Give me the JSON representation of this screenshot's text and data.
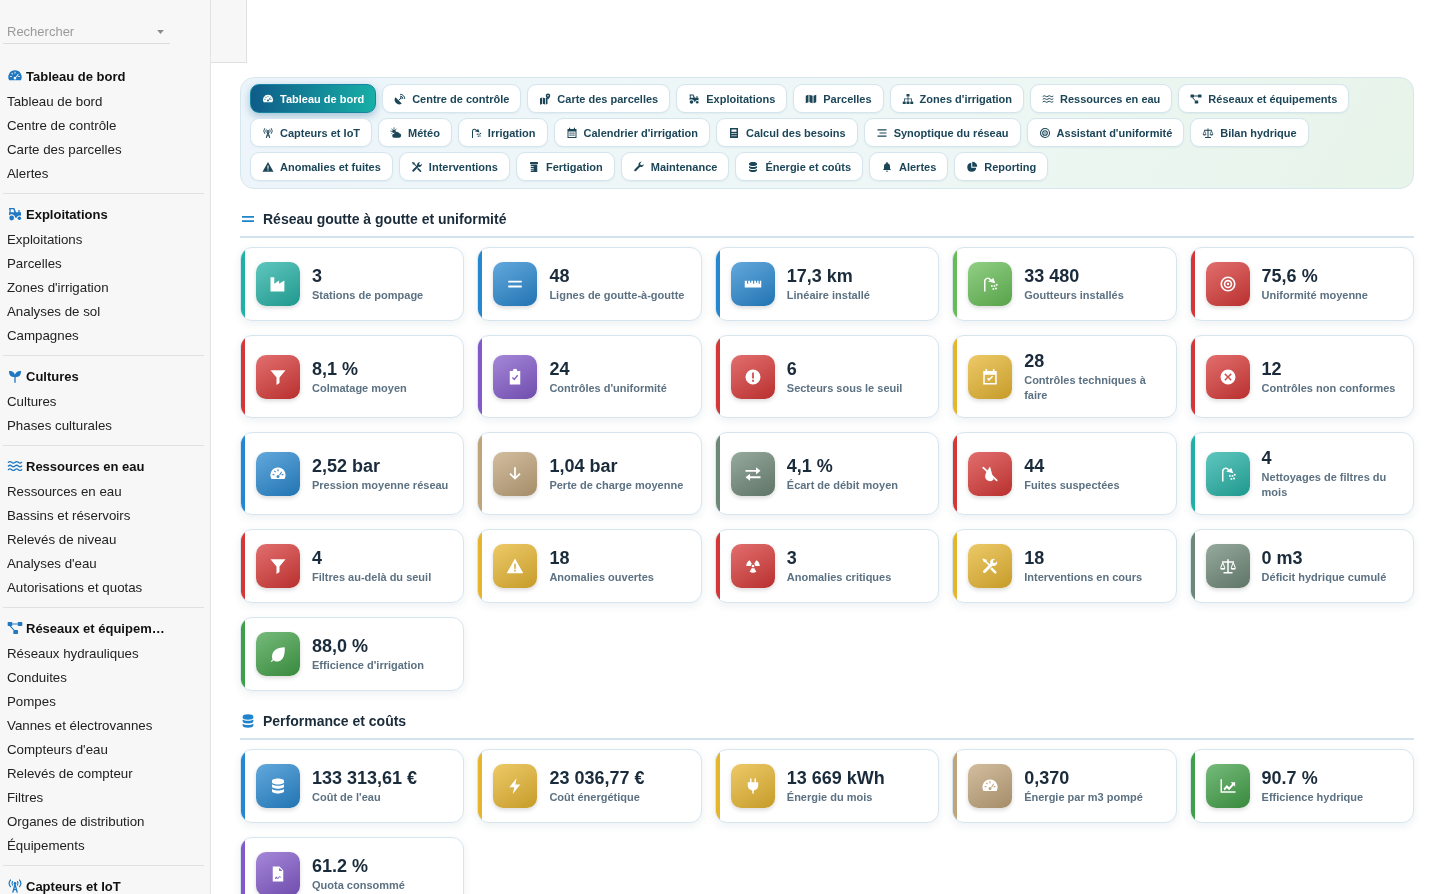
{
  "sidebar": {
    "search": {
      "placeholder": "Rechercher"
    },
    "groups": [
      {
        "title": "Tableau de bord",
        "items": [
          "Tableau de bord",
          "Centre de contrôle",
          "Carte des parcelles",
          "Alertes"
        ]
      },
      {
        "title": "Exploitations",
        "items": [
          "Exploitations",
          "Parcelles",
          "Zones d'irrigation",
          "Analyses de sol",
          "Campagnes"
        ]
      },
      {
        "title": "Cultures",
        "items": [
          "Cultures",
          "Phases culturales"
        ]
      },
      {
        "title": "Ressources en eau",
        "items": [
          "Ressources en eau",
          "Bassins et réservoirs",
          "Relevés de niveau",
          "Analyses d'eau",
          "Autorisations et quotas"
        ]
      },
      {
        "title": "Réseaux et équipem…",
        "items": [
          "Réseaux hydrauliques",
          "Conduites",
          "Pompes",
          "Vannes et électrovannes",
          "Compteurs d'eau",
          "Relevés de compteur",
          "Filtres",
          "Organes de distribution",
          "Équipements"
        ]
      },
      {
        "title": "Capteurs et IoT"
      }
    ]
  },
  "tab_rows": [
    {
      "tabs": [
        {
          "label": "Tableau de bord",
          "selected": true
        },
        {
          "label": "Centre de contrôle",
          "selected": false
        },
        {
          "label": "Carte des parcelles",
          "selected": false
        },
        {
          "label": "Exploitations",
          "selected": false
        },
        {
          "label": "Parcelles",
          "selected": false
        },
        {
          "label": "Zones d'irrigation",
          "selected": false
        },
        {
          "label": "Ressources en eau",
          "selected": false
        },
        {
          "label": "Réseaux et équipements",
          "selected": false
        }
      ]
    },
    {
      "tabs": [
        {
          "label": "Capteurs et IoT",
          "selected": false
        },
        {
          "label": "Météo",
          "selected": false
        },
        {
          "label": "Irrigation",
          "selected": false
        },
        {
          "label": "Calendrier d'irrigation",
          "selected": false
        },
        {
          "label": "Calcul des besoins",
          "selected": false
        },
        {
          "label": "Synoptique du réseau",
          "selected": false
        },
        {
          "label": "Assistant d'uniformité",
          "selected": false
        },
        {
          "label": "Bilan hydrique",
          "selected": false
        }
      ]
    },
    {
      "tabs": [
        {
          "label": "Anomalies et fuites",
          "selected": false
        },
        {
          "label": "Interventions",
          "selected": false
        },
        {
          "label": "Fertigation",
          "selected": false
        },
        {
          "label": "Maintenance",
          "selected": false
        },
        {
          "label": "Énergie et coûts",
          "selected": false
        },
        {
          "label": "Alertes",
          "selected": false
        },
        {
          "label": "Reporting",
          "selected": false
        }
      ]
    }
  ],
  "sections": [
    {
      "title": "Réseau goutte à goutte et uniformité",
      "kpis": [
        {
          "value": "3",
          "label": "Stations de pompage",
          "color": "#1fb1a5"
        },
        {
          "value": "48",
          "label": "Lignes de goutte-à-goutte",
          "color": "#2487cf"
        },
        {
          "value": "17,3 km",
          "label": "Linéaire installé",
          "color": "#2487cf"
        },
        {
          "value": "33 480",
          "label": "Goutteurs installés",
          "color": "#66bd55"
        },
        {
          "value": "75,6 %",
          "label": "Uniformité moyenne",
          "color": "#d63636"
        },
        {
          "value": "8,1 %",
          "label": "Colmatage moyen",
          "color": "#d63636"
        },
        {
          "value": "24",
          "label": "Contrôles d'uniformité",
          "color": "#8259c9"
        },
        {
          "value": "6",
          "label": "Secteurs sous le seuil",
          "color": "#d63636"
        },
        {
          "value": "28",
          "label": "Contrôles techniques à faire",
          "color": "#e6b52c"
        },
        {
          "value": "12",
          "label": "Contrôles non conformes",
          "color": "#d63636"
        },
        {
          "value": "2,52 bar",
          "label": "Pression moyenne réseau",
          "color": "#2487cf"
        },
        {
          "value": "1,04 bar",
          "label": "Perte de charge moyenne",
          "color": "#c0a47a"
        },
        {
          "value": "4,1 %",
          "label": "Écart de débit moyen",
          "color": "#6e8878"
        },
        {
          "value": "44",
          "label": "Fuites suspectées",
          "color": "#d63636"
        },
        {
          "value": "4",
          "label": "Nettoyages de filtres du mois",
          "color": "#1fb1a5"
        },
        {
          "value": "4",
          "label": "Filtres au-delà du seuil",
          "color": "#d63636"
        },
        {
          "value": "18",
          "label": "Anomalies ouvertes",
          "color": "#e6b52c"
        },
        {
          "value": "3",
          "label": "Anomalies critiques",
          "color": "#d63636"
        },
        {
          "value": "18",
          "label": "Interventions en cours",
          "color": "#e6b52c"
        },
        {
          "value": "0 m3",
          "label": "Déficit hydrique cumulé",
          "color": "#6e8878"
        },
        {
          "value": "88,0 %",
          "label": "Efficience d'irrigation",
          "color": "#40a047"
        }
      ]
    },
    {
      "title": "Performance et coûts",
      "kpis": [
        {
          "value": "133 313,61 €",
          "label": "Coût de l'eau",
          "color": "#2487cf"
        },
        {
          "value": "23 036,77 €",
          "label": "Coût énergétique",
          "color": "#e6b52c"
        },
        {
          "value": "13 669 kWh",
          "label": "Énergie du mois",
          "color": "#e6b52c"
        },
        {
          "value": "0,370",
          "label": "Énergie par m3 pompé",
          "color": "#c0a47a"
        },
        {
          "value": "90.7 %",
          "label": "Efficience hydrique",
          "color": "#40a047"
        },
        {
          "value": "61.2 %",
          "label": "Quota consommé",
          "color": "#8259c9"
        }
      ]
    }
  ]
}
